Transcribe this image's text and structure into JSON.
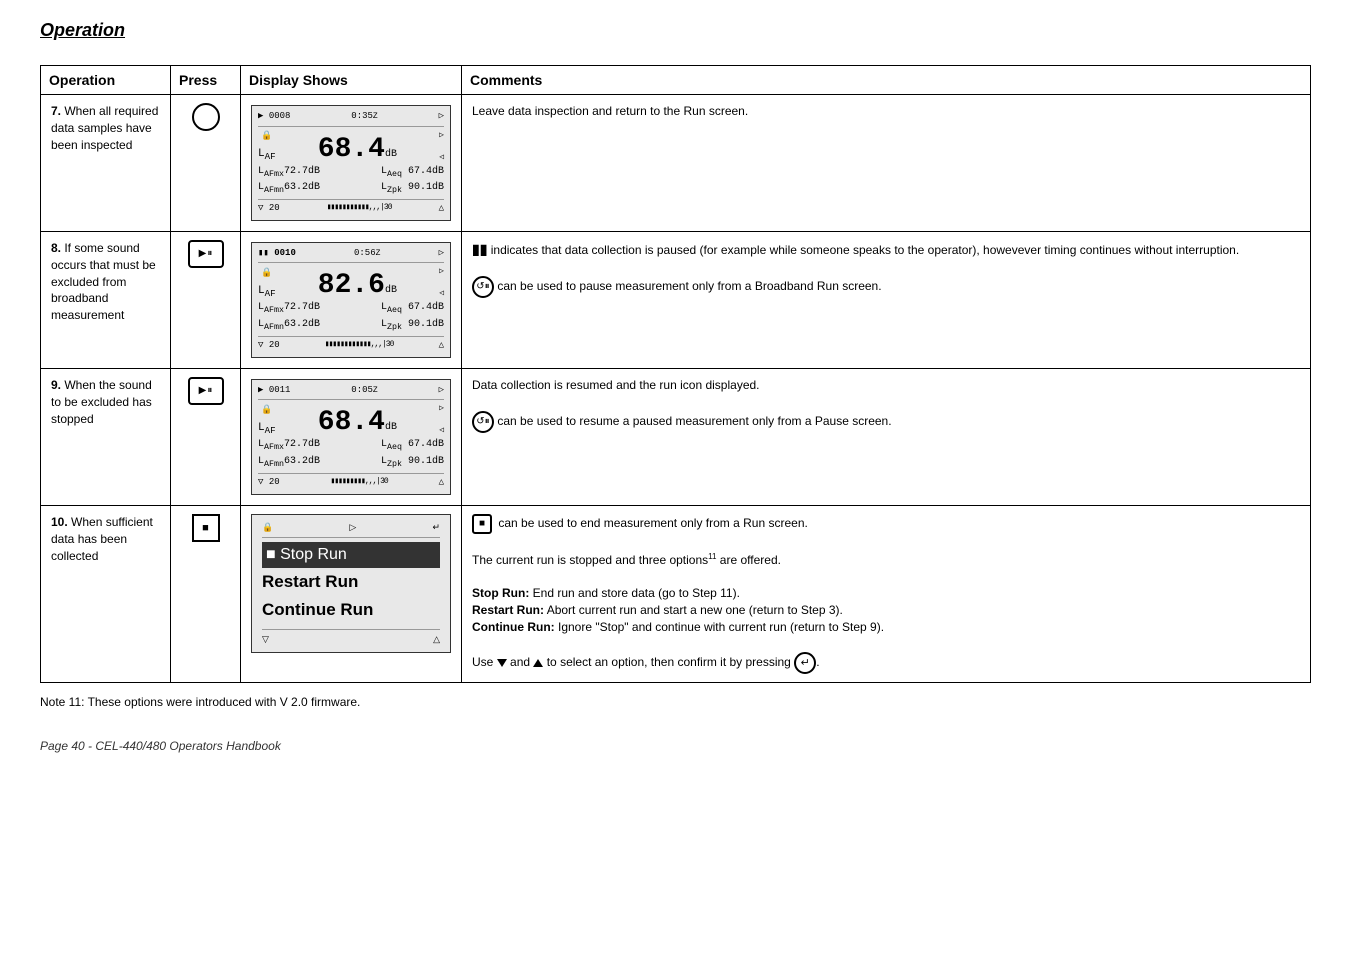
{
  "page": {
    "title": "Operation",
    "footer": "Page 40 - CEL-440/480 Operators Handbook",
    "note": "Note 11:  These options were introduced with V 2.0 firmware."
  },
  "table": {
    "headers": {
      "operation": "Operation",
      "press": "Press",
      "display": "Display Shows",
      "comments": "Comments"
    },
    "rows": [
      {
        "step": "7.",
        "operation": "When all required data samples have been inspected",
        "display_id": "display_7",
        "comments": [
          "Leave data inspection and return to the Run screen."
        ]
      },
      {
        "step": "8.",
        "operation": "If some sound occurs that must be excluded from broadband measurement",
        "display_id": "display_8",
        "comments": [
          "indicates that data collection is paused (for example while someone speaks to the operator), howevever timing continues without interruption.",
          "can be used to pause measurement only from a Broadband Run screen."
        ]
      },
      {
        "step": "9.",
        "operation": "When the sound to be excluded has stopped",
        "display_id": "display_9",
        "comments": [
          "Data collection is resumed and the run icon displayed.",
          "can be used to resume a paused measurement only from a Pause screen."
        ]
      },
      {
        "step": "10.",
        "operation": "When sufficient data has been collected",
        "display_id": "display_10",
        "comments": [
          "can be used to end measurement only from a Run screen.",
          "The current run is stopped and three options",
          "are offered.",
          "Stop Run: End run and store data (go to Step 11).",
          "Restart Run: Abort current run and start a new one (return to Step 3).",
          "Continue Run: Ignore \"Stop\" and continue with current run (return to Step 9).",
          "Use",
          "and",
          "to select an option, then confirm it by pressing"
        ]
      }
    ],
    "displays": {
      "display_7": {
        "top_left": "▶ 0008",
        "top_right": "0:35",
        "main_num": "68.4",
        "unit": "dB",
        "row1_left": "LAFmx72.7dB",
        "row1_right": "LAeq  67.4dB",
        "row2_left": "LAFmn63.2dB",
        "row2_right": "LZpk  90.1dB",
        "bottom_left": "▽ 20",
        "bottom_bar": "▮▮▮▮▮▮▮▮▮▮▮▮▮▮, , , |30",
        "bottom_right": "△",
        "sub": "AF"
      },
      "display_8": {
        "top_left": "▮▮ 0010",
        "top_right": "0:56",
        "main_num": "82.6",
        "unit": "dB",
        "row1_left": "LAFmx72.7dB",
        "row1_right": "LAeq  67.4dB",
        "row2_left": "LAFmn63.2dB",
        "row2_right": "LZpk  90.1dB",
        "bottom_left": "▽ 20",
        "bottom_bar": "▮▮▮▮▮▮▮▮▮▮▮▮▮▮▮▮▮▮, , , |30",
        "bottom_right": "△",
        "sub": "AF"
      },
      "display_9": {
        "top_left": "▶ 0011",
        "top_right": "0:05",
        "main_num": "68.4",
        "unit": "dB",
        "row1_left": "LAFmx72.7dB",
        "row1_right": "LAeq  67.4dB",
        "row2_left": "LAFmn63.2dB",
        "row2_right": "LZpk  90.1dB",
        "bottom_left": "▽ 20",
        "bottom_bar": "▮▮▮▮▮▮▮▮▮▮▮▮, , , |30",
        "bottom_right": "△",
        "sub": "AF"
      },
      "display_10": {
        "menu_items": [
          "Stop Run",
          "Restart Run",
          "Continue Run"
        ],
        "selected": 0,
        "bottom_left": "▽",
        "bottom_right": "△"
      }
    }
  }
}
